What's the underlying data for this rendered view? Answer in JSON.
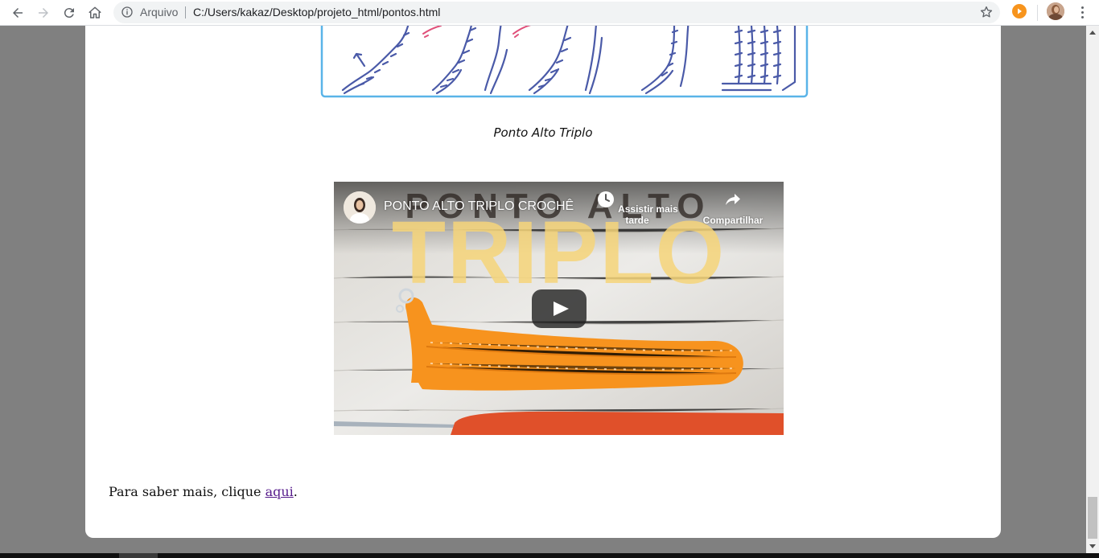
{
  "browser": {
    "security_chip": "Arquivo",
    "url": "C:/Users/kakaz/Desktop/projeto_html/pontos.html"
  },
  "page": {
    "image_caption": "Ponto Alto Triplo",
    "video": {
      "title": "PONTO ALTO TRIPLO CROCHÊ",
      "watch_later_label": "Assistir mais tarde",
      "share_label": "Compartilhar",
      "thumbnail_line1": "PONTO ALTO",
      "thumbnail_line2": "TRIPLO"
    },
    "footer": {
      "prefix": "Para saber mais, clique ",
      "link_text": "aqui",
      "suffix": "."
    }
  },
  "colors": {
    "accent_extension": "#f7941d",
    "link": "#551a8b",
    "diagram_stitch": "#4a5aa8",
    "diagram_hook": "#e0507a",
    "diagram_border": "#5ab4e8",
    "yarn": "#f7931e",
    "hook": "#e0502a"
  }
}
